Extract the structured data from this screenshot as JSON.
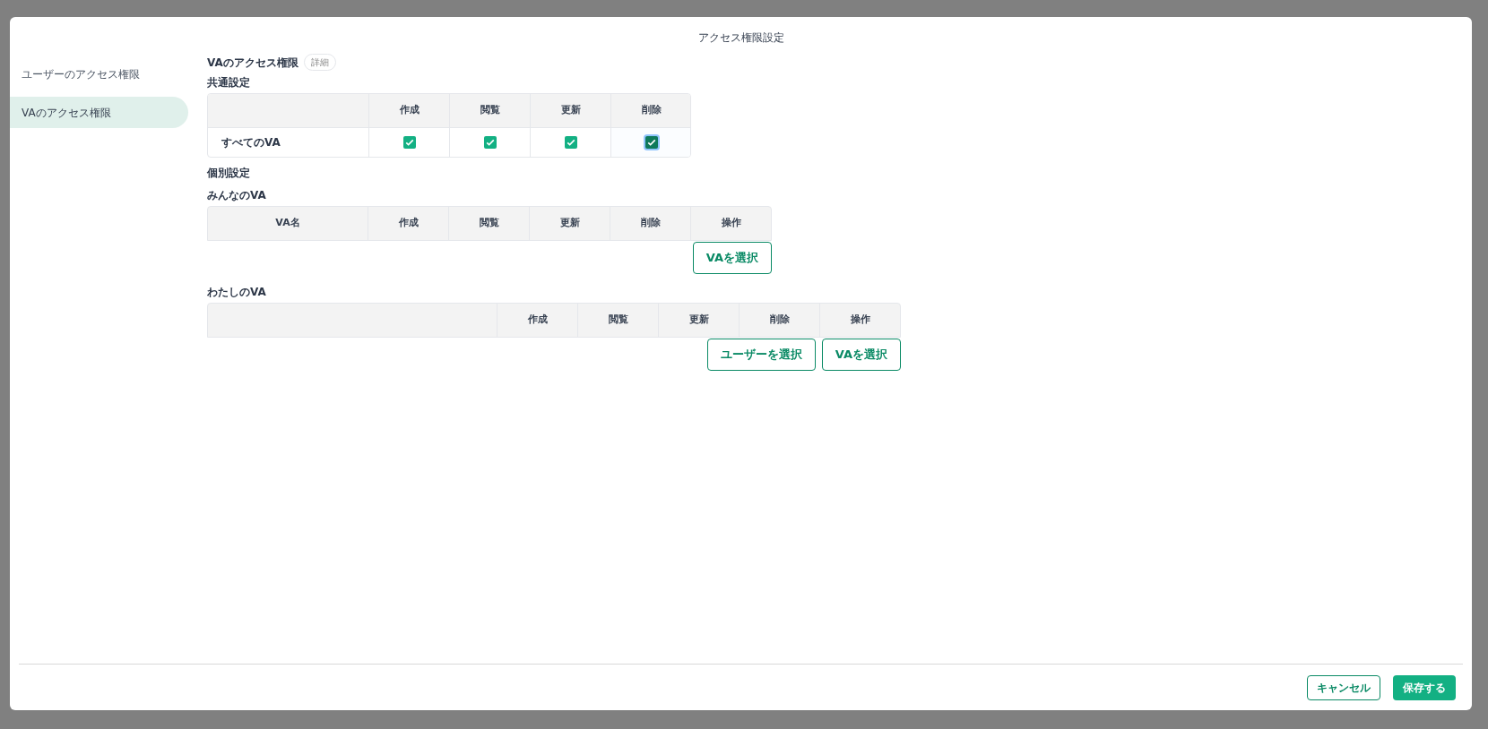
{
  "dialog": {
    "title": "アクセス権限設定"
  },
  "sidebar": {
    "items": [
      {
        "label": "ユーザーのアクセス権限",
        "selected": false
      },
      {
        "label": "VAのアクセス権限",
        "selected": true
      }
    ]
  },
  "section": {
    "title": "VAのアクセス権限",
    "badge": "詳細"
  },
  "common": {
    "title": "共通設定",
    "columns": [
      "",
      "作成",
      "閲覧",
      "更新",
      "削除"
    ],
    "rows": [
      {
        "name": "すべてのVA",
        "permissions": [
          {
            "checked": true,
            "focused": false
          },
          {
            "checked": true,
            "focused": false
          },
          {
            "checked": true,
            "focused": false
          },
          {
            "checked": true,
            "focused": true
          }
        ]
      }
    ]
  },
  "individual": {
    "title": "個別設定",
    "groups": [
      {
        "title": "みんなのVA",
        "columns": [
          "VA名",
          "作成",
          "閲覧",
          "更新",
          "削除",
          "操作"
        ],
        "first_wide": false,
        "buttons": [
          "VAを選択"
        ]
      },
      {
        "title": "わたしのVA",
        "columns": [
          "",
          "作成",
          "閲覧",
          "更新",
          "削除",
          "操作"
        ],
        "first_wide": true,
        "buttons": [
          "ユーザーを選択",
          "VAを選択"
        ]
      }
    ]
  },
  "footer": {
    "cancel": "キャンセル",
    "save": "保存する"
  }
}
